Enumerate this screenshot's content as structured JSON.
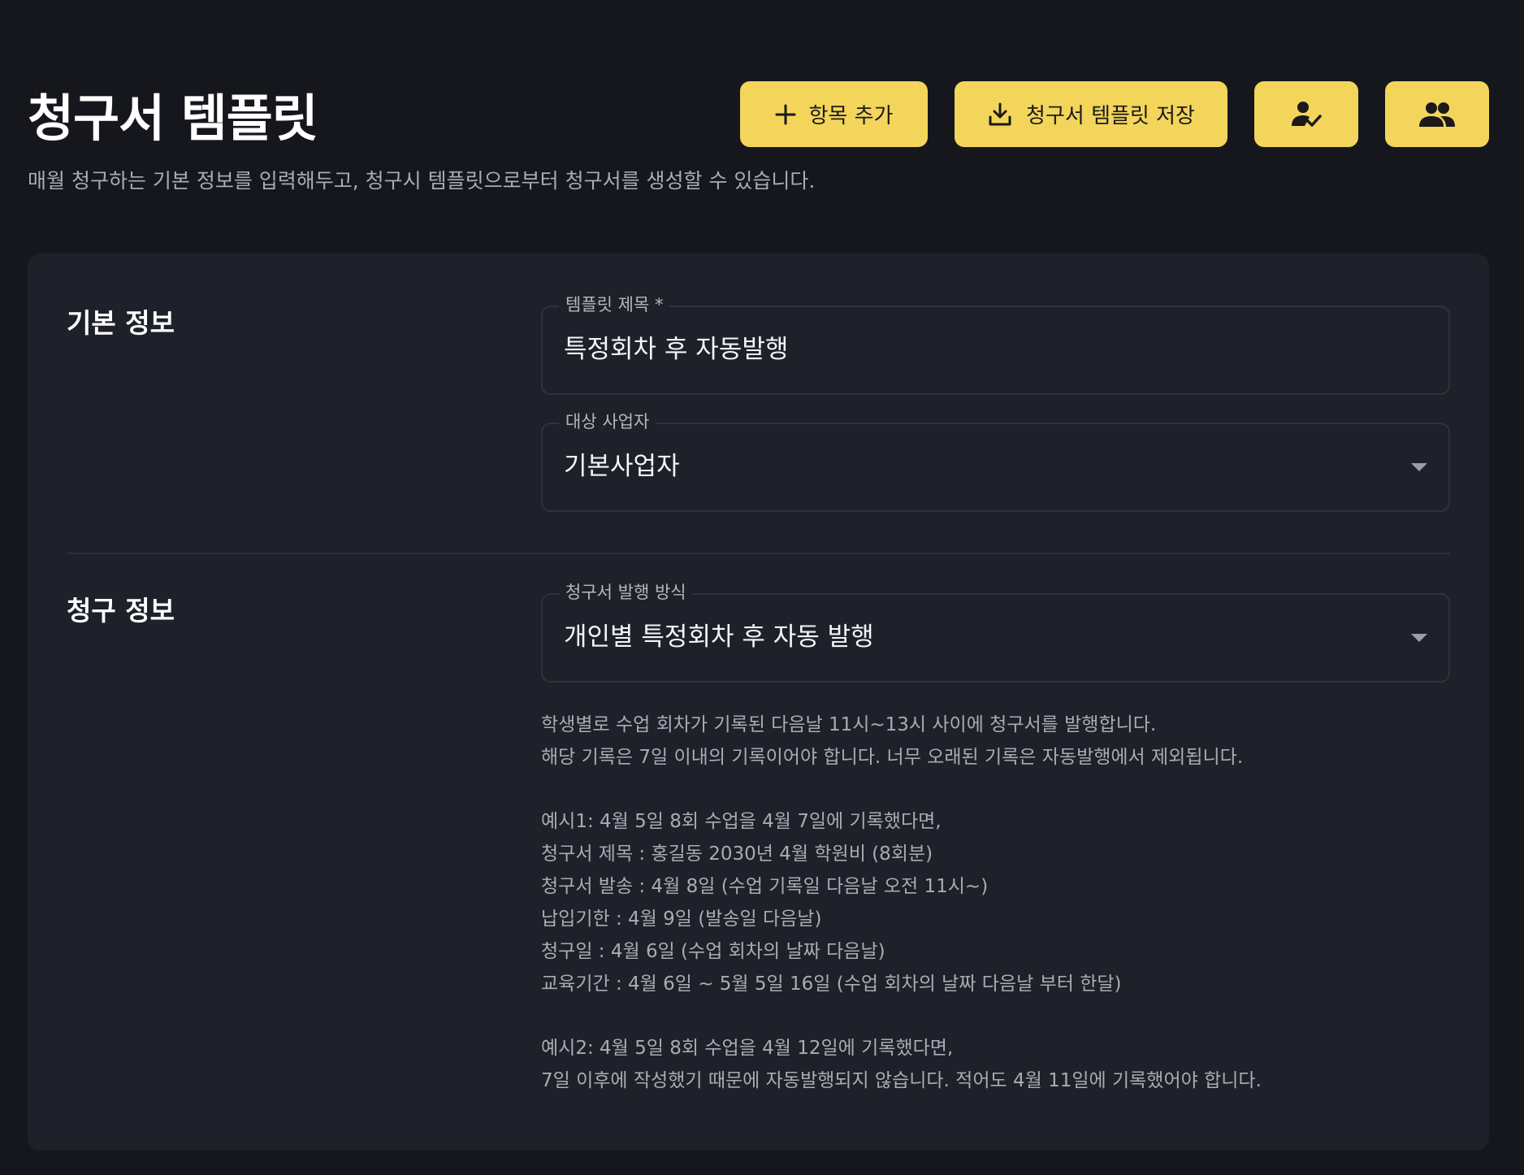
{
  "header": {
    "title": "청구서 템플릿",
    "subtitle": "매월 청구하는 기본 정보를 입력해두고, 청구시 템플릿으로부터 청구서를 생성할 수 있습니다."
  },
  "toolbar": {
    "add_item_label": "항목 추가",
    "save_template_label": "청구서 템플릿 저장",
    "assign_user_icon": "person-check-icon",
    "users_icon": "group-icon",
    "accent_color": "#f3d55b"
  },
  "basic_info": {
    "section_label": "기본 정보",
    "template_title": {
      "label": "템플릿 제목 *",
      "value": "특정회차 후 자동발행"
    },
    "business": {
      "label": "대상 사업자",
      "value": "기본사업자"
    }
  },
  "billing_info": {
    "section_label": "청구 정보",
    "issue_method": {
      "label": "청구서 발행 방식",
      "value": "개인별 특정회차 후 자동 발행"
    },
    "help": {
      "intro": [
        "학생별로 수업 회차가 기록된 다음날 11시~13시 사이에 청구서를 발행합니다.",
        "해당 기록은 7일 이내의 기록이어야 합니다. 너무 오래된 기록은 자동발행에서 제외됩니다."
      ],
      "example1": [
        "예시1: 4월 5일 8회 수업을 4월 7일에 기록했다면,",
        "청구서 제목 : 홍길동 2030년 4월 학원비 (8회분)",
        "청구서 발송 : 4월 8일 (수업 기록일 다음날 오전 11시~)",
        "납입기한 : 4월 9일 (발송일 다음날)",
        "청구일 : 4월 6일 (수업 회차의 날짜 다음날)",
        "교육기간 : 4월 6일 ~ 5월 5일 16일 (수업 회차의 날짜 다음날 부터 한달)"
      ],
      "example2": [
        "예시2: 4월 5일 8회 수업을 4월 12일에 기록했다면,",
        "7일 이후에 작성했기 때문에 자동발행되지 않습니다. 적어도 4월 11일에 기록했어야 합니다."
      ]
    }
  }
}
